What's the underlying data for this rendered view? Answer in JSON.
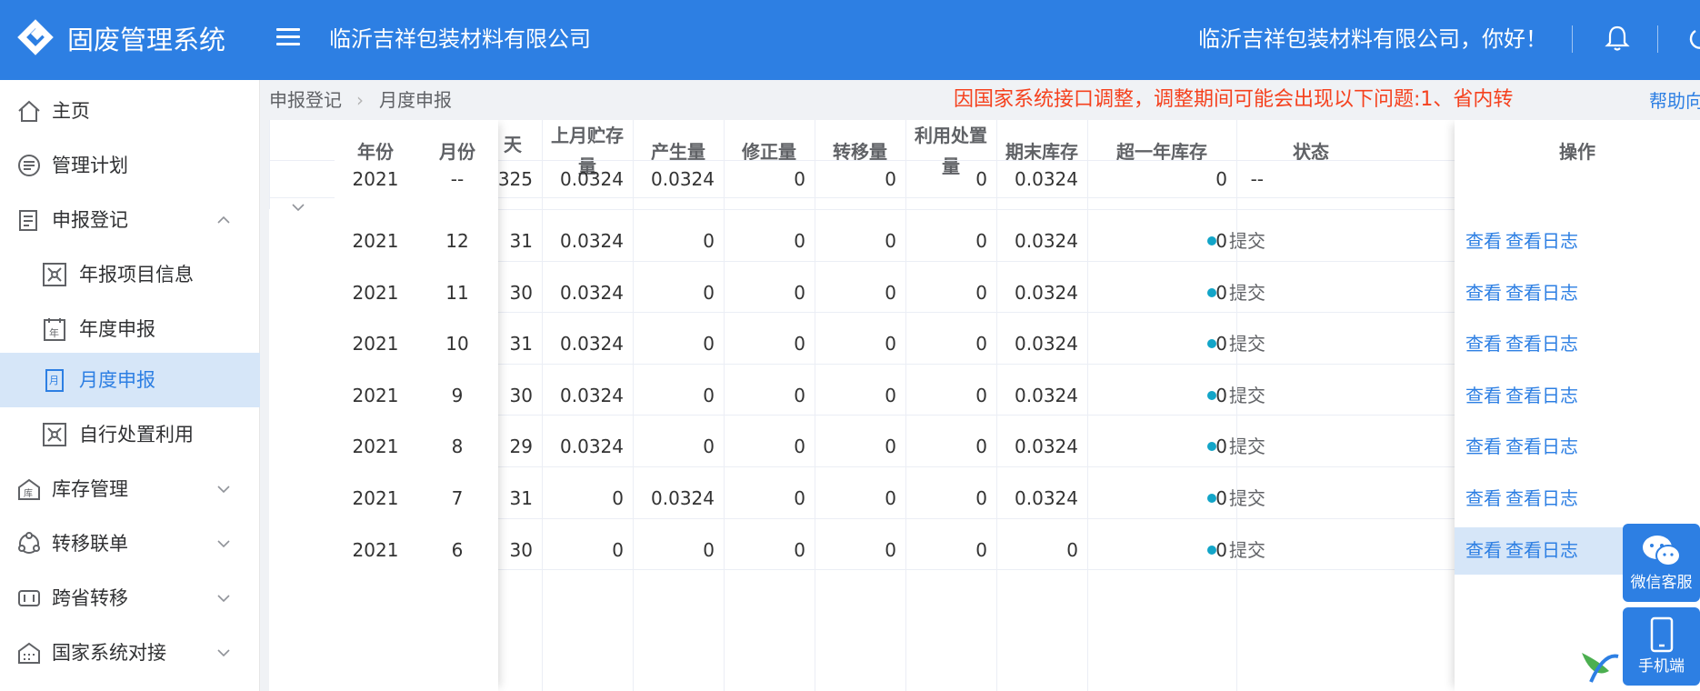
{
  "header": {
    "app_title": "固废管理系统",
    "company": "临沂吉祥包装材料有限公司",
    "greeting": "临沂吉祥包装材料有限公司，你好！",
    "icons": [
      "logo-diamond",
      "menu-icon",
      "bell-icon",
      "power-icon"
    ]
  },
  "sidebar": {
    "items": [
      {
        "label": "主页",
        "icon": "home-icon"
      },
      {
        "label": "管理计划",
        "icon": "plan-icon"
      },
      {
        "label": "申报登记",
        "icon": "register-icon",
        "expanded": true
      },
      {
        "label": "年报项目信息",
        "icon": "project-info-icon"
      },
      {
        "label": "年度申报",
        "icon": "calendar-year-icon"
      },
      {
        "label": "月度申报",
        "icon": "calendar-month-icon",
        "active": true
      },
      {
        "label": "自行处置利用",
        "icon": "self-dispose-icon"
      },
      {
        "label": "库存管理",
        "icon": "warehouse-icon"
      },
      {
        "label": "转移联单",
        "icon": "transfer-icon"
      },
      {
        "label": "跨省转移",
        "icon": "cross-province-icon"
      },
      {
        "label": "国家系统对接",
        "icon": "national-link-icon"
      }
    ]
  },
  "breadcrumb": {
    "items": [
      "申报登记",
      "月度申报"
    ]
  },
  "notice": "因国家系统接口调整，调整期间可能会出现以下问题:1、省内转",
  "help": "帮助向",
  "table": {
    "headers": {
      "year": "年份",
      "month": "月份",
      "days": "天",
      "prev_stock_1": "上月贮存",
      "prev_stock_2": "量",
      "produced": "产生量",
      "corrected": "修正量",
      "transferred": "转移量",
      "used_1": "利用处置",
      "used_2": "量",
      "end_stock": "期末库存",
      "over_year": "超一年库存",
      "status": "状态",
      "ops": "操作"
    },
    "summary": {
      "year": "2021",
      "month": "--",
      "days": "325",
      "prev_stock": "0.0324",
      "produced": "0.0324",
      "corrected": "0",
      "transferred": "0",
      "used": "0",
      "end_stock": "0.0324",
      "over_year": "0",
      "status": "--"
    },
    "rows": [
      {
        "year": "2021",
        "month": "12",
        "days": "31",
        "prev_stock": "0.0324",
        "produced": "0",
        "corrected": "0",
        "transferred": "0",
        "used": "0",
        "end_stock": "0.0324",
        "over_year": "0",
        "status": "提交",
        "view": "查看",
        "log": "查看日志"
      },
      {
        "year": "2021",
        "month": "11",
        "days": "30",
        "prev_stock": "0.0324",
        "produced": "0",
        "corrected": "0",
        "transferred": "0",
        "used": "0",
        "end_stock": "0.0324",
        "over_year": "0",
        "status": "提交",
        "view": "查看",
        "log": "查看日志"
      },
      {
        "year": "2021",
        "month": "10",
        "days": "31",
        "prev_stock": "0.0324",
        "produced": "0",
        "corrected": "0",
        "transferred": "0",
        "used": "0",
        "end_stock": "0.0324",
        "over_year": "0",
        "status": "提交",
        "view": "查看",
        "log": "查看日志"
      },
      {
        "year": "2021",
        "month": "9",
        "days": "30",
        "prev_stock": "0.0324",
        "produced": "0",
        "corrected": "0",
        "transferred": "0",
        "used": "0",
        "end_stock": "0.0324",
        "over_year": "0",
        "status": "提交",
        "view": "查看",
        "log": "查看日志"
      },
      {
        "year": "2021",
        "month": "8",
        "days": "29",
        "prev_stock": "0.0324",
        "produced": "0",
        "corrected": "0",
        "transferred": "0",
        "used": "0",
        "end_stock": "0.0324",
        "over_year": "0",
        "status": "提交",
        "view": "查看",
        "log": "查看日志"
      },
      {
        "year": "2021",
        "month": "7",
        "days": "31",
        "prev_stock": "0",
        "produced": "0.0324",
        "corrected": "0",
        "transferred": "0",
        "used": "0",
        "end_stock": "0.0324",
        "over_year": "0",
        "status": "提交",
        "view": "查看",
        "log": "查看日志"
      },
      {
        "year": "2021",
        "month": "6",
        "days": "30",
        "prev_stock": "0",
        "produced": "0",
        "corrected": "0",
        "transferred": "0",
        "used": "0",
        "end_stock": "0",
        "over_year": "0",
        "status": "提交",
        "view": "查看",
        "log": "查看日志"
      }
    ]
  },
  "float": {
    "wechat": "微信客服",
    "mobile": "手机端"
  },
  "colors": {
    "primary": "#2d7fe3",
    "notice": "#f5411e",
    "status_dot": "#13a5c8",
    "active_bg": "#d6e6f8"
  }
}
